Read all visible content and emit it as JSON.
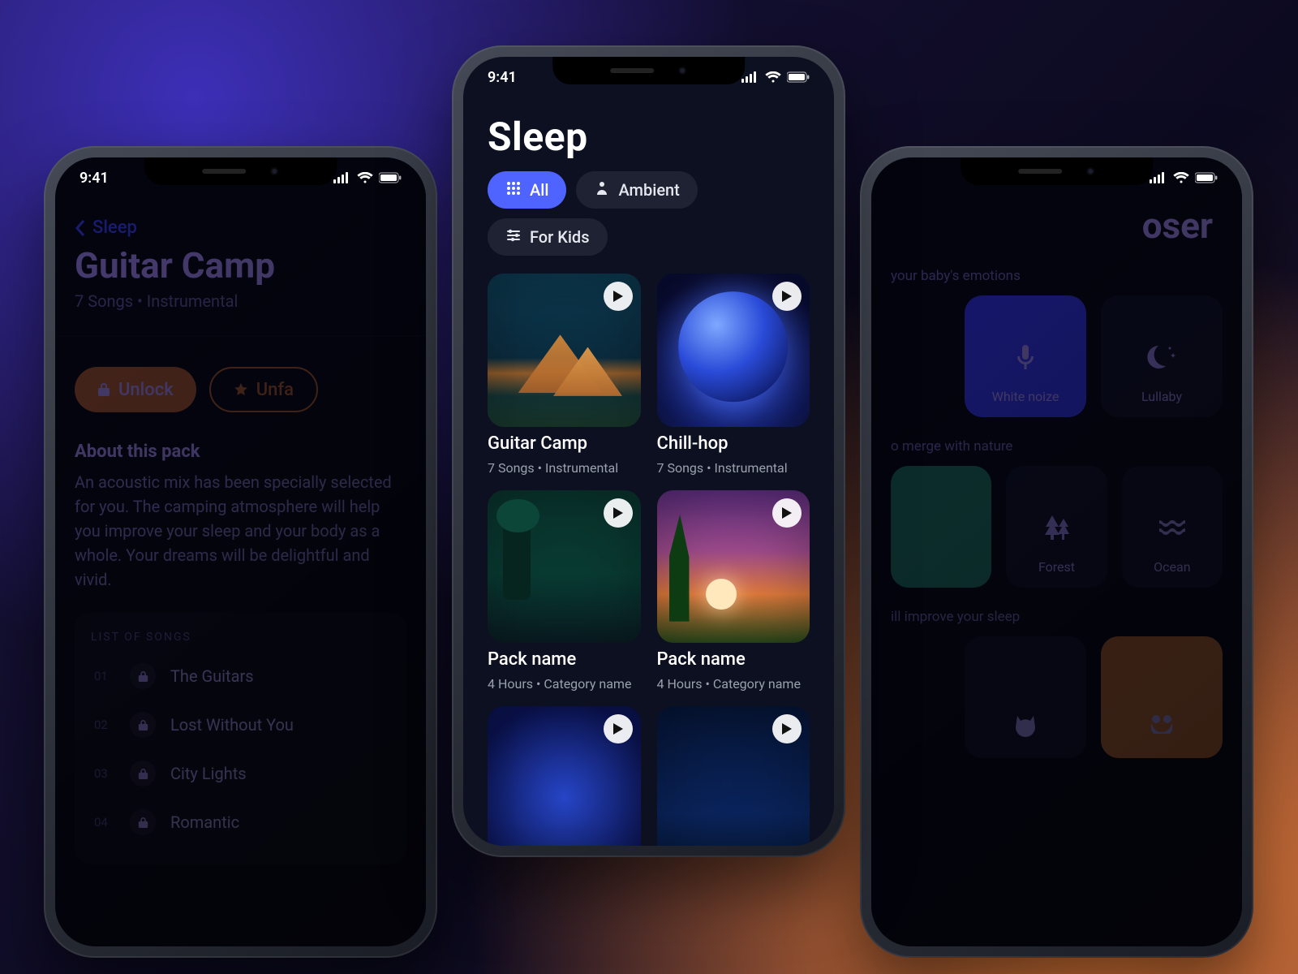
{
  "status": {
    "time": "9:41"
  },
  "center": {
    "title": "Sleep",
    "chips": [
      {
        "label": "All",
        "active": true
      },
      {
        "label": "Ambient",
        "active": false
      },
      {
        "label": "For Kids",
        "active": false
      }
    ],
    "packs": [
      {
        "title": "Guitar Camp",
        "meta": "7 Songs  •  Instrumental",
        "art": "camp"
      },
      {
        "title": "Chill-hop",
        "meta": "7 Songs  •  Instrumental",
        "art": "planet"
      },
      {
        "title": "Pack name",
        "meta": "4 Hours  •  Category name",
        "art": "forest"
      },
      {
        "title": "Pack name",
        "meta": "4 Hours  •  Category name",
        "art": "sunset"
      },
      {
        "title": "",
        "meta": "",
        "art": "night1"
      },
      {
        "title": "",
        "meta": "",
        "art": "night2"
      }
    ]
  },
  "left": {
    "back": "Sleep",
    "title": "Guitar Camp",
    "sub": "7 Songs  •  Instrumental",
    "unlock": "Unlock",
    "unfav": "Unfa",
    "about_heading": "About this pack",
    "about_body": "An acoustic mix has been specially selected for you. The camping atmosphere will help you improve your sleep and your body as a whole. Your dreams will be delightful and vivid.",
    "list_label": "LIST OF SONGS",
    "songs": [
      {
        "num": "01",
        "title": "The Guitars"
      },
      {
        "num": "02",
        "title": "Lost Without You"
      },
      {
        "num": "03",
        "title": "City Lights"
      },
      {
        "num": "04",
        "title": "Romantic"
      }
    ]
  },
  "right": {
    "title": "oser",
    "sections": [
      {
        "hint": "your baby's emotions",
        "tiles": [
          {
            "label": "White noize",
            "icon": "mic",
            "variant": "active"
          },
          {
            "label": "Lullaby",
            "icon": "moon",
            "variant": ""
          }
        ]
      },
      {
        "hint": "o merge with nature",
        "tiles": [
          {
            "label": "",
            "icon": "",
            "variant": "green"
          },
          {
            "label": "Forest",
            "icon": "trees",
            "variant": ""
          },
          {
            "label": "Ocean",
            "icon": "waves",
            "variant": ""
          }
        ]
      },
      {
        "hint": "ill improve your sleep",
        "tiles": [
          {
            "label": "",
            "icon": "cat",
            "variant": ""
          },
          {
            "label": "",
            "icon": "frog",
            "variant": "orange"
          }
        ]
      }
    ]
  }
}
